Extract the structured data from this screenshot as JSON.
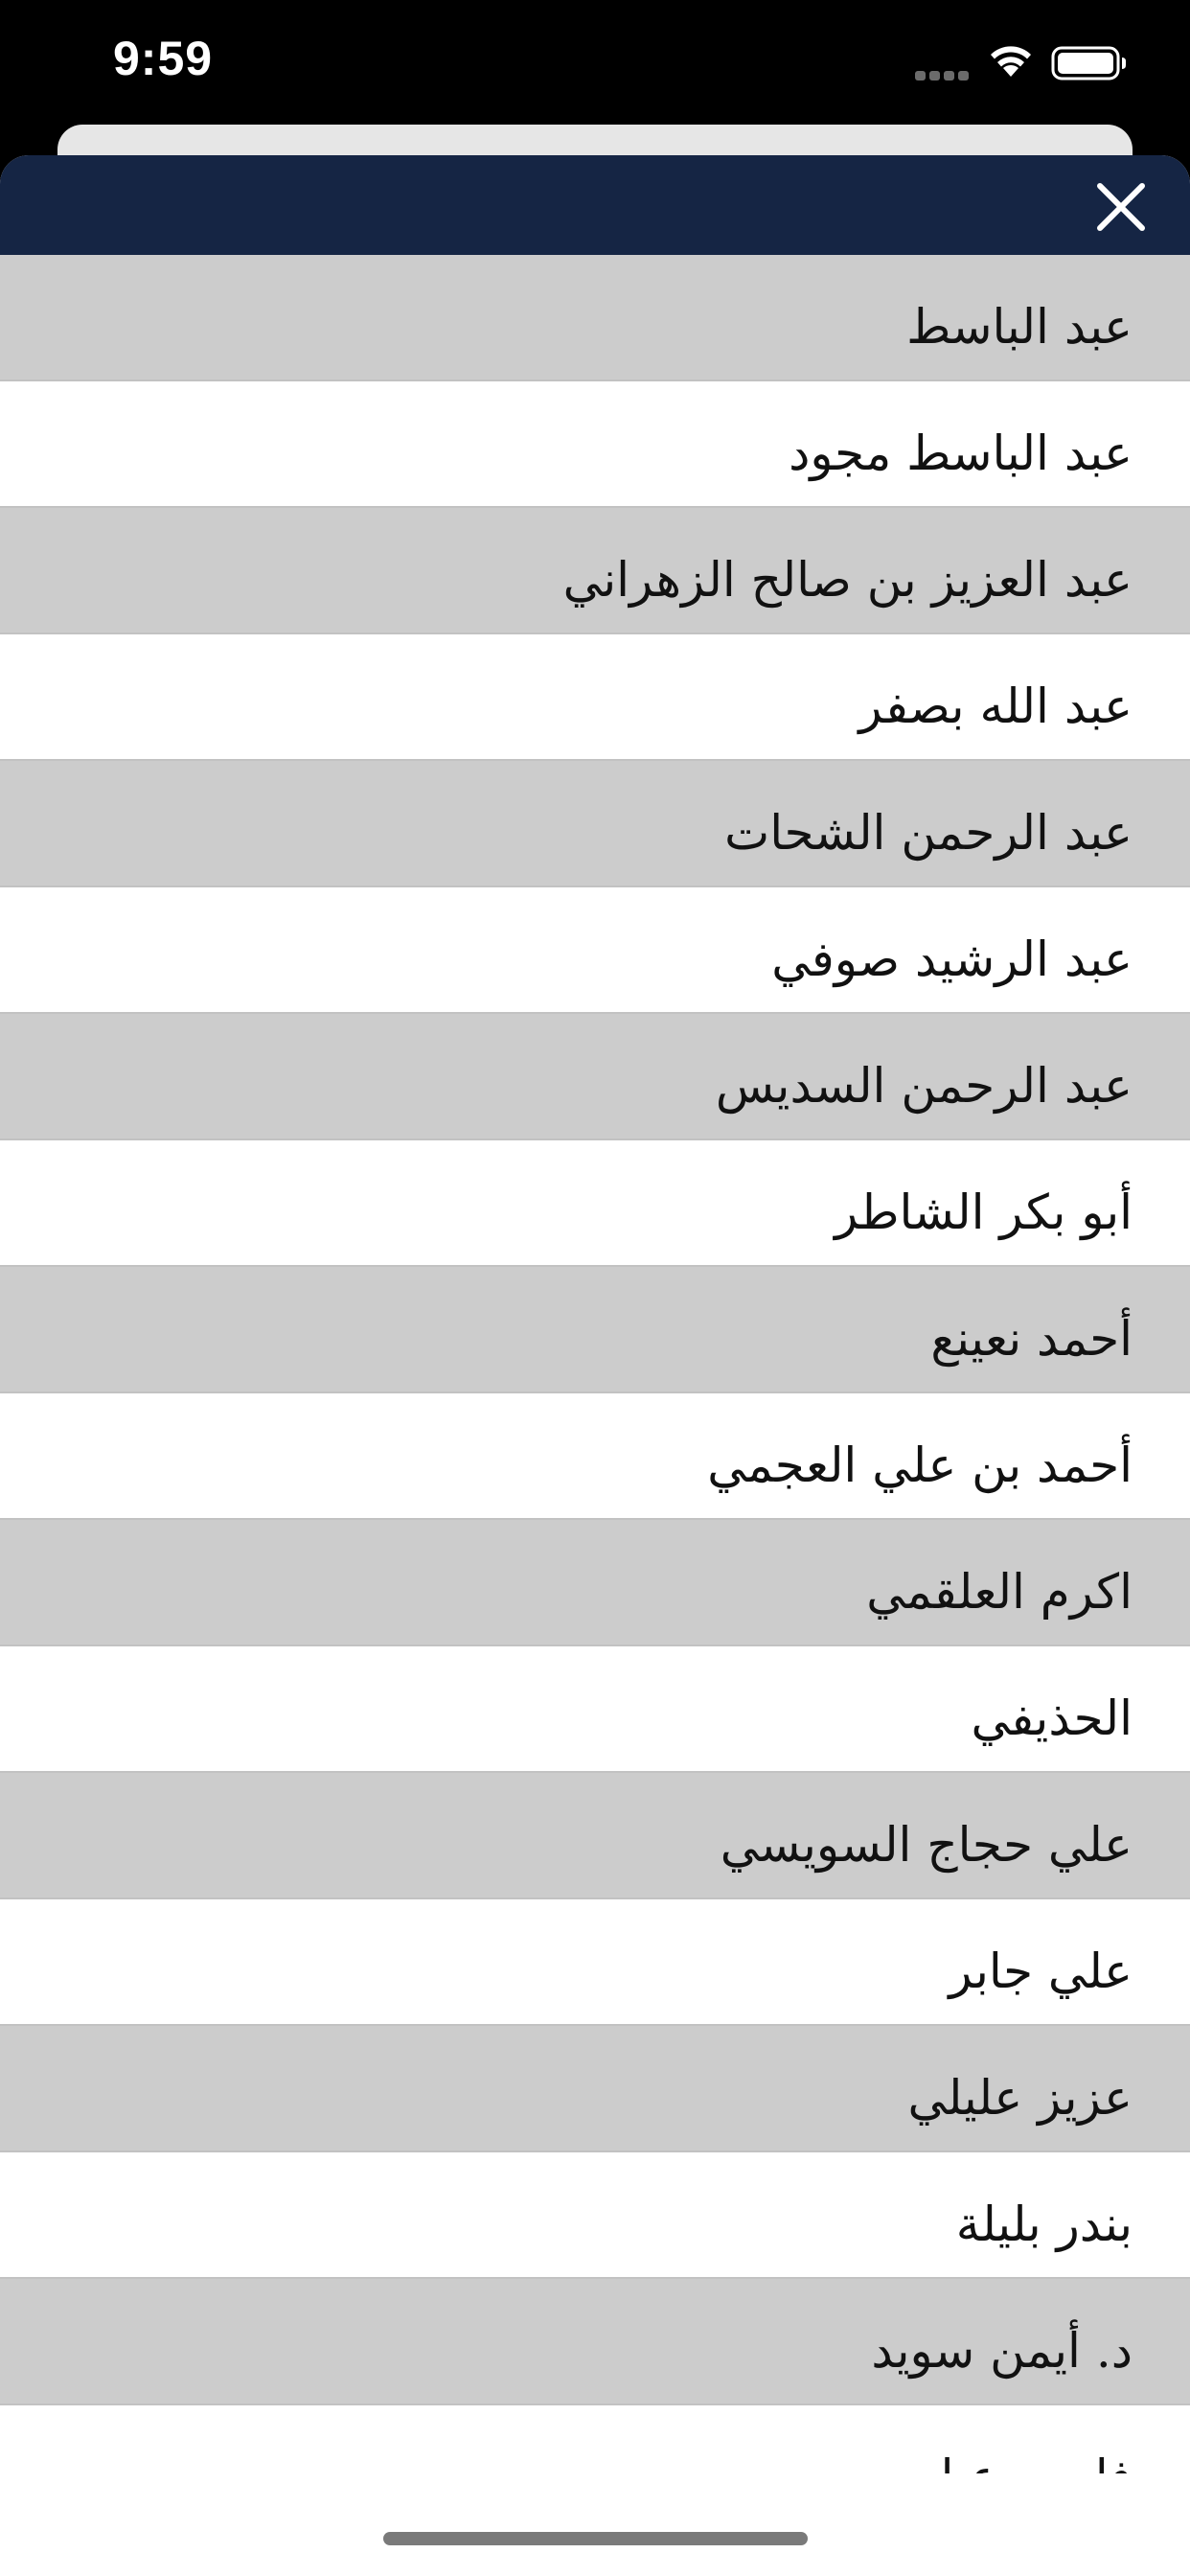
{
  "status_bar": {
    "time": "9:59",
    "icons": [
      "signal-dots-icon",
      "wifi-icon",
      "battery-icon"
    ]
  },
  "header": {
    "background_color": "#152544",
    "close_icon": "close-icon"
  },
  "colors": {
    "row_shaded": "#cccccc",
    "row_plain": "#ffffff",
    "divider": "#c2c2c2",
    "text": "#111111"
  },
  "reciters": [
    {
      "label": "عبد الباسط",
      "shaded": true
    },
    {
      "label": "عبد الباسط مجود",
      "shaded": false
    },
    {
      "label": "عبد العزيز بن صالح الزهراني",
      "shaded": true
    },
    {
      "label": "عبد الله بصفر",
      "shaded": false
    },
    {
      "label": "عبد الرحمن الشحات",
      "shaded": true
    },
    {
      "label": "عبد الرشيد صوفي",
      "shaded": false
    },
    {
      "label": "عبد الرحمن السديس",
      "shaded": true
    },
    {
      "label": "أبو بكر الشاطر",
      "shaded": false
    },
    {
      "label": "أحمد نعينع",
      "shaded": true
    },
    {
      "label": "أحمد بن علي العجمي",
      "shaded": false
    },
    {
      "label": "اكرم العلقمي",
      "shaded": true
    },
    {
      "label": "الحذيفي",
      "shaded": false
    },
    {
      "label": "علي حجاج السويسي",
      "shaded": true
    },
    {
      "label": "علي جابر",
      "shaded": false
    },
    {
      "label": "عزيز عليلي",
      "shaded": true
    },
    {
      "label": "بندر بليلة",
      "shaded": false
    },
    {
      "label": "د. أيمن سويد",
      "shaded": true
    },
    {
      "label": "فارس عباد",
      "shaded": false
    }
  ]
}
